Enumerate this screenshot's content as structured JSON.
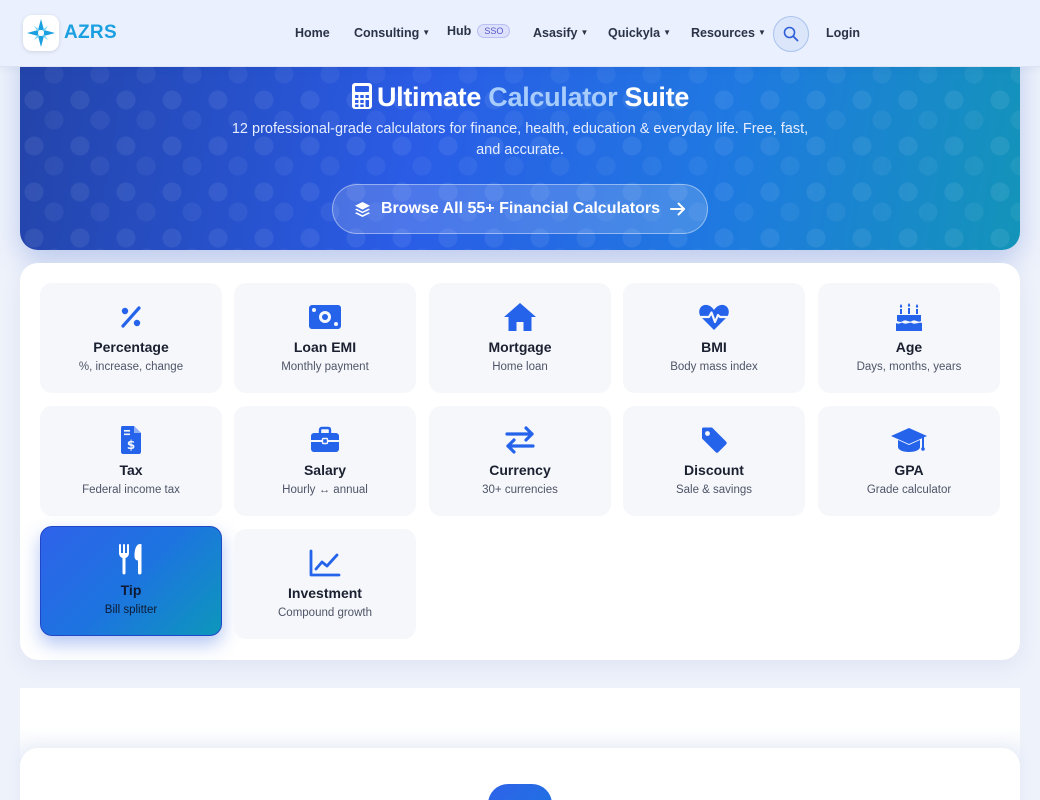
{
  "nav": {
    "brand": "AZRS",
    "items": [
      {
        "label": "Home",
        "dropdown": false
      },
      {
        "label": "Consulting",
        "dropdown": true
      },
      {
        "label": "Hub",
        "badge": "SSO",
        "dropdown": false
      },
      {
        "label": "Asasify",
        "dropdown": true
      },
      {
        "label": "Quickyla",
        "dropdown": true
      },
      {
        "label": "Resources",
        "dropdown": true
      }
    ],
    "search_icon": "search-icon",
    "login": "Login"
  },
  "hero": {
    "title_part1": "Ultimate",
    "title_accent": "Calculator",
    "title_part2": "Suite",
    "subtitle": "12 professional-grade calculators for finance, health, education & everyday life. Free, fast, and accurate.",
    "cta": "Browse All 55+ Financial Calculators"
  },
  "calculators": [
    {
      "title": "Percentage",
      "subtitle": "%, increase, change",
      "icon": "percent-icon"
    },
    {
      "title": "Loan EMI",
      "subtitle": "Monthly payment",
      "icon": "money-bill-icon"
    },
    {
      "title": "Mortgage",
      "subtitle": "Home loan",
      "icon": "house-icon"
    },
    {
      "title": "BMI",
      "subtitle": "Body mass index",
      "icon": "heart-pulse-icon"
    },
    {
      "title": "Age",
      "subtitle": "Days, months, years",
      "icon": "birthday-cake-icon"
    },
    {
      "title": "Tax",
      "subtitle": "Federal income tax",
      "icon": "invoice-dollar-icon"
    },
    {
      "title": "Salary",
      "subtitle": "Hourly ↔ annual",
      "icon": "briefcase-icon"
    },
    {
      "title": "Currency",
      "subtitle": "30+ currencies",
      "icon": "exchange-arrows-icon"
    },
    {
      "title": "Discount",
      "subtitle": "Sale & savings",
      "icon": "tag-icon"
    },
    {
      "title": "GPA",
      "subtitle": "Grade calculator",
      "icon": "graduation-cap-icon"
    },
    {
      "title": "Tip",
      "subtitle": "Bill splitter",
      "icon": "utensils-icon",
      "active": true
    },
    {
      "title": "Investment",
      "subtitle": "Compound growth",
      "icon": "chart-line-icon"
    }
  ],
  "colors": {
    "accent": "#2563eb",
    "brand": "#1a9fe0",
    "hero_accent": "#a8cdfd"
  }
}
